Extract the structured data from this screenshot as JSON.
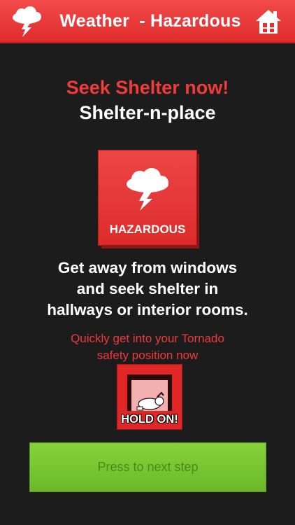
{
  "header": {
    "title": "Weather  - Hazardous",
    "storm_icon": "storm-cloud-icon",
    "home_icon": "home-icon"
  },
  "alert": {
    "headline": "Seek Shelter now!",
    "subheadline": "Shelter-n-place"
  },
  "hazard_card": {
    "icon": "storm-cloud-icon",
    "label": "HAZARDOUS"
  },
  "instructions": {
    "lines": [
      "Get away from windows",
      "and seek shelter in",
      "hallways or interior rooms."
    ]
  },
  "tip": {
    "lines": [
      "Quickly get into your Tornado",
      "safety position now"
    ]
  },
  "hold_on": {
    "icon": "crouching-person-icon",
    "label": "HOLD ON!"
  },
  "next_button": {
    "label": "Press to next step"
  },
  "colors": {
    "header_red": "#e83535",
    "headline_red": "#f03b3b",
    "background": "#1c1c1c",
    "button_green": "#78c532"
  }
}
